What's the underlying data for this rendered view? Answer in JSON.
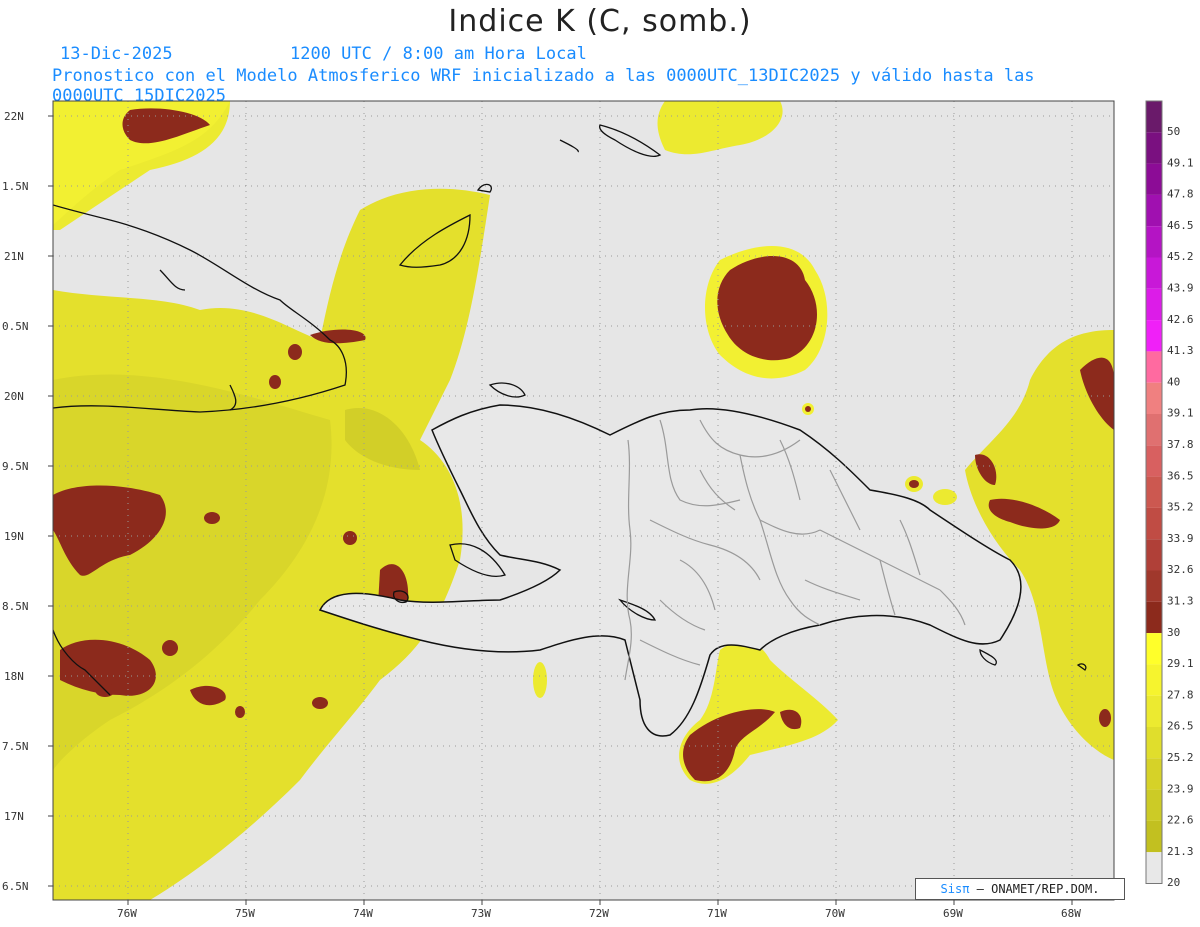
{
  "title": "Indice K (C, somb.)",
  "date": "13-Dic-2025",
  "time_label": "1200 UTC / 8:00 am Hora Local",
  "description": "Pronostico con el Modelo Atmosferico WRF inicializado a las 0000UTC_13DIC2025 y válido hasta las  0000UTC_15DIC2025",
  "credit": {
    "sis": "Sisπ",
    "rest": "– ONAMET/REP.DOM."
  },
  "lat_labels": [
    "22N",
    "1.5N",
    "21N",
    "0.5N",
    "20N",
    "9.5N",
    "19N",
    "8.5N",
    "18N",
    "7.5N",
    "17N",
    "6.5N"
  ],
  "lon_labels": [
    "76W",
    "75W",
    "74W",
    "73W",
    "72W",
    "71W",
    "70W",
    "69W",
    "68W"
  ],
  "colorbar": {
    "labels": [
      "50",
      "49.1",
      "47.8",
      "46.5",
      "45.2",
      "43.9",
      "42.6",
      "41.3",
      "40",
      "39.1",
      "37.8",
      "36.5",
      "35.2",
      "33.9",
      "32.6",
      "31.3",
      "30",
      "29.1",
      "27.8",
      "26.5",
      "25.2",
      "23.9",
      "22.6",
      "21.3",
      "20"
    ],
    "colors": [
      "#6a1a6a",
      "#7a1080",
      "#8c0c96",
      "#a010b0",
      "#b414c4",
      "#c818d8",
      "#dc1ce8",
      "#f020f8",
      "#ff6aa0",
      "#f08080",
      "#e07070",
      "#d86060",
      "#cc5850",
      "#c04c44",
      "#b04038",
      "#a0382c",
      "#8c2a1c",
      "#ffff2a",
      "#f6f42e",
      "#ecea30",
      "#e0de2c",
      "#d6d228",
      "#cccb26",
      "#c2c020",
      "#e8e8e8"
    ]
  },
  "legend_meaning": "K index (C), shaded"
}
